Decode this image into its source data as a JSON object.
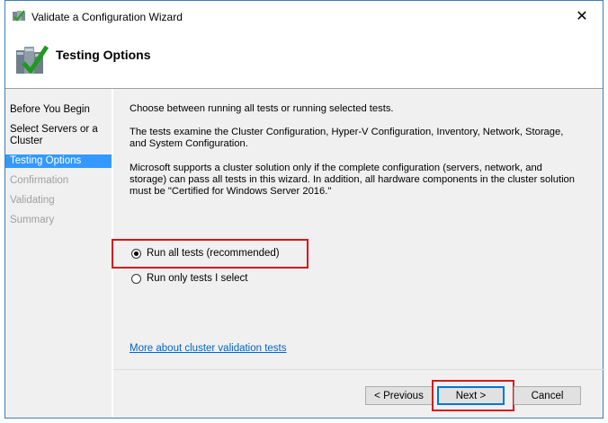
{
  "window": {
    "title": "Validate a Configuration Wizard",
    "close_glyph": "✕",
    "icon": "cluster-wizard-icon"
  },
  "header": {
    "title": "Testing Options",
    "icon": "checklist-icon"
  },
  "sidebar": {
    "items": [
      {
        "label": "Before You Begin",
        "state": "normal"
      },
      {
        "label": "Select Servers or a Cluster",
        "state": "normal"
      },
      {
        "label": "Testing Options",
        "state": "selected"
      },
      {
        "label": "Confirmation",
        "state": "disabled"
      },
      {
        "label": "Validating",
        "state": "disabled"
      },
      {
        "label": "Summary",
        "state": "disabled"
      }
    ]
  },
  "main": {
    "intro": "Choose between running all tests or running selected tests.",
    "tests_desc": "The tests examine the Cluster Configuration, Hyper-V Configuration, Inventory, Network, Storage, and System Configuration.",
    "support_note": "Microsoft supports a cluster solution only if the complete configuration (servers, network, and storage) can pass all tests in this wizard. In addition, all hardware components in the cluster solution must be \"Certified for Windows Server 2016.\"",
    "options": [
      {
        "label": "Run all tests (recommended)",
        "checked": true
      },
      {
        "label": "Run only tests I select",
        "checked": false
      }
    ],
    "more_link": "More about cluster validation tests"
  },
  "footer": {
    "previous_label": "< Previous",
    "next_label": "Next >",
    "cancel_label": "Cancel"
  },
  "colors": {
    "selected_bg": "#3399ff",
    "highlight_red": "#d8161e",
    "link": "#0066cc"
  }
}
